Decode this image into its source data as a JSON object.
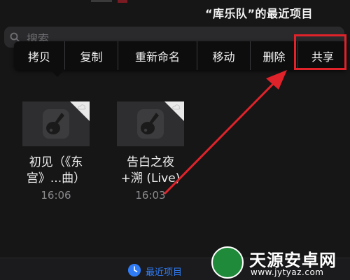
{
  "header": {
    "title": "“库乐队”的最近项目"
  },
  "search": {
    "placeholder": "搜索"
  },
  "context_menu": {
    "items": [
      {
        "label": "拷贝"
      },
      {
        "label": "复制"
      },
      {
        "label": "重新命名"
      },
      {
        "label": "移动"
      },
      {
        "label": "删除"
      },
      {
        "label": "共享"
      }
    ],
    "highlighted_item": "共享"
  },
  "files": [
    {
      "name_line1": "初见（《东",
      "name_line2": "宫》...曲）",
      "time": "16:06"
    },
    {
      "name_line1": "告白之夜",
      "name_line2": "+溯 (Live)",
      "time": "16:03"
    }
  ],
  "tabbar": {
    "active_tab": "最近项目"
  },
  "watermark": {
    "title": "天源安卓网",
    "url": "www.jytyaz.com"
  },
  "colors": {
    "accent": "#2f7cf6",
    "highlight": "#e0222a",
    "background": "#161616",
    "menu": "#0d0d0e"
  },
  "icons": {
    "search": "magnifier-icon",
    "file_thumbnail": "guitar-icon",
    "tab": "clock-icon",
    "cloud": "cloud-icon"
  }
}
